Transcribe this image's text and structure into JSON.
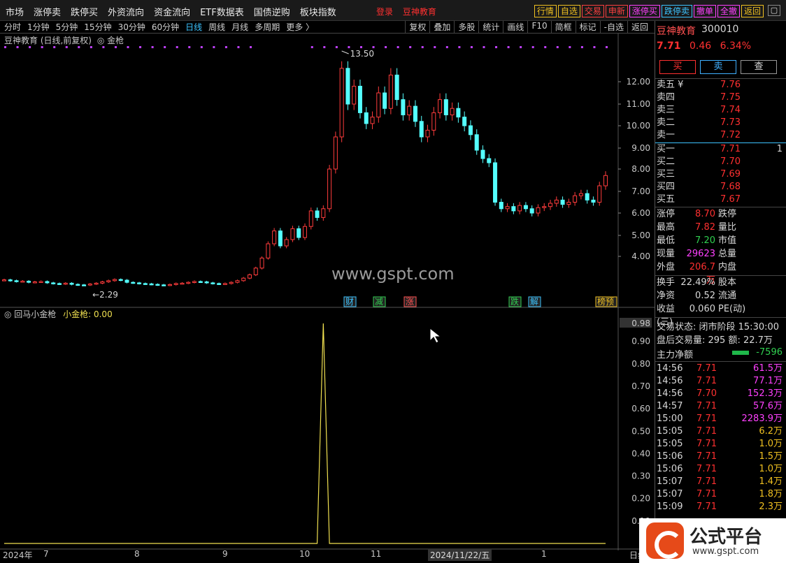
{
  "top_menu": [
    "市场",
    "涨停卖",
    "跌停买",
    "外资流向",
    "资金流向",
    "ETF数据表",
    "国债逆购",
    "板块指数"
  ],
  "brand": {
    "login": "登录",
    "name": "豆神教育"
  },
  "quick_buttons": [
    {
      "label": "行情",
      "color": "#f0c020"
    },
    {
      "label": "自选",
      "color": "#f0c020"
    },
    {
      "label": "交易",
      "color": "#ff4040"
    },
    {
      "label": "申新",
      "color": "#ff4040"
    },
    {
      "label": "涨停买",
      "color": "#ff40ff"
    },
    {
      "label": "跌停卖",
      "color": "#3cc3ff"
    },
    {
      "label": "撤单",
      "color": "#ff40ff"
    },
    {
      "label": "全撤",
      "color": "#ff40ff"
    },
    {
      "label": "返回",
      "color": "#f0c020"
    }
  ],
  "periods": [
    {
      "label": "分时",
      "active": false
    },
    {
      "label": "1分钟",
      "active": false
    },
    {
      "label": "5分钟",
      "active": false
    },
    {
      "label": "15分钟",
      "active": false
    },
    {
      "label": "30分钟",
      "active": false
    },
    {
      "label": "60分钟",
      "active": false
    },
    {
      "label": "日线",
      "active": true
    },
    {
      "label": "周线",
      "active": false
    },
    {
      "label": "月线",
      "active": false
    },
    {
      "label": "多周期",
      "active": false
    },
    {
      "label": "更多 〉",
      "active": false
    }
  ],
  "tools": [
    "复权",
    "叠加",
    "多股",
    "统计",
    "画线",
    "F10",
    "简框",
    "标记",
    "-自选",
    "返回"
  ],
  "main_chart": {
    "title": "豆神教育 (日线,前复权)",
    "indicator": "◎ 金枪",
    "high_label": "13.50",
    "low_label": "2.29",
    "watermark": "www.gspt.com",
    "event_tags": [
      {
        "label": "财",
        "color": "#3cc3ff"
      },
      {
        "label": "减",
        "color": "#30d050"
      },
      {
        "label": "涨",
        "color": "#ff5050"
      },
      {
        "label": "跌",
        "color": "#30d050"
      },
      {
        "label": "解",
        "color": "#3cc3ff"
      },
      {
        "label": "榜预",
        "color": "#f0c020"
      }
    ]
  },
  "sub_chart": {
    "title": "◎ 回马小金枪",
    "value_label": "小金枪: 0.00",
    "max_label": "0.98"
  },
  "dates": {
    "year": "2024年",
    "months": [
      "7",
      "8",
      "9",
      "10",
      "11",
      "1"
    ],
    "cursor_date": "2024/11/22/五",
    "end": "日线"
  },
  "chart_data": [
    {
      "type": "candlestick",
      "title": "豆神教育 (日线,前复权)",
      "y_axis_ticks": [
        "12.00",
        "11.00",
        "10.00",
        "9.00",
        "8.00",
        "7.00",
        "6.00",
        "5.00",
        "4.00"
      ],
      "close_series": [
        2.6,
        2.55,
        2.5,
        2.52,
        2.45,
        2.48,
        2.5,
        2.42,
        2.38,
        2.35,
        2.4,
        2.33,
        2.3,
        2.29,
        2.35,
        2.4,
        2.48,
        2.55,
        2.62,
        2.58,
        2.45,
        2.42,
        2.38,
        2.36,
        2.33,
        2.3,
        2.28,
        2.32,
        2.38,
        2.4,
        2.45,
        2.5,
        2.48,
        2.42,
        2.38,
        2.35,
        2.38,
        2.45,
        2.55,
        2.7,
        2.9,
        3.3,
        3.9,
        4.6,
        5.2,
        4.5,
        4.8,
        5.3,
        4.9,
        5.4,
        6.1,
        5.8,
        6.2,
        8.0,
        9.5,
        12.6,
        11.0,
        11.8,
        10.6,
        10.1,
        10.4,
        11.5,
        10.8,
        12.3,
        11.2,
        10.5,
        10.9,
        10.2,
        9.5,
        9.8,
        10.6,
        11.2,
        10.5,
        10.8,
        10.4,
        10.0,
        9.6,
        8.9,
        8.5,
        8.3,
        6.5,
        6.2,
        6.3,
        6.1,
        6.35,
        6.2,
        6.0,
        6.25,
        6.3,
        6.45,
        6.6,
        6.4,
        6.5,
        6.8,
        6.9,
        6.6,
        6.5,
        7.25,
        7.71
      ],
      "high_marker": "13.50",
      "low_marker": "2.29"
    },
    {
      "type": "line",
      "title": "回马小金枪",
      "series_name": "小金枪",
      "y_axis_ticks": [
        "0.98",
        "0.90",
        "0.80",
        "0.70",
        "0.60",
        "0.50",
        "0.40",
        "0.30",
        "0.20",
        "0.10"
      ],
      "spike_index": 52,
      "spike_value": 0.98,
      "last_value": 0.0
    }
  ],
  "right_panel": {
    "name": "豆神教育",
    "code": "300010",
    "price": "7.71",
    "change": "0.46",
    "change_pct": "6.34%",
    "buttons": {
      "buy": "买",
      "sell": "卖",
      "query": "查"
    },
    "asks": [
      {
        "label": "卖五 ¥",
        "price": "7.76"
      },
      {
        "label": "卖四",
        "price": "7.75"
      },
      {
        "label": "卖三",
        "price": "7.74"
      },
      {
        "label": "卖二",
        "price": "7.73"
      },
      {
        "label": "卖一",
        "price": "7.72"
      }
    ],
    "bids": [
      {
        "label": "买一",
        "price": "7.71",
        "vol": "1"
      },
      {
        "label": "买二",
        "price": "7.70",
        "vol": ""
      },
      {
        "label": "买三",
        "price": "7.69",
        "vol": ""
      },
      {
        "label": "买四",
        "price": "7.68",
        "vol": ""
      },
      {
        "label": "买五",
        "price": "7.67",
        "vol": ""
      }
    ],
    "stats": [
      {
        "k": "涨停",
        "v": "8.70",
        "color": "#ff3030",
        "k2": "跌停"
      },
      {
        "k": "最高",
        "v": "7.82",
        "color": "#ff3030",
        "k2": "量比"
      },
      {
        "k": "最低",
        "v": "7.20",
        "color": "#30d050",
        "k2": "市值"
      },
      {
        "k": "现量",
        "v": "29623",
        "color": "#ff40ff",
        "k2": "总量"
      },
      {
        "k": "外盘",
        "v": "206.7万",
        "color": "#ff3030",
        "k2": "内盘"
      }
    ],
    "stats2": [
      {
        "k": "换手",
        "v": "22.49%",
        "color": "#d8d8d8",
        "k2": "股本"
      },
      {
        "k": "净资",
        "v": "0.52",
        "color": "#d8d8d8",
        "k2": "流通"
      },
      {
        "k": "收益(三)",
        "v": "0.060",
        "color": "#d8d8d8",
        "k2": "PE(动)"
      }
    ],
    "trade_status": "交易状态: 闭市阶段 15:30:00",
    "after_hours": "盘后交易量: 295  额: 22.7万",
    "main_flow_label": "主力净额",
    "main_flow_value": "-7596",
    "ticks": [
      {
        "t": "14:56",
        "p": "7.71",
        "v": "61.5万",
        "c": "#ff40ff"
      },
      {
        "t": "14:56",
        "p": "7.71",
        "v": "77.1万",
        "c": "#ff40ff"
      },
      {
        "t": "14:56",
        "p": "7.70",
        "v": "152.3万",
        "c": "#ff40ff"
      },
      {
        "t": "14:57",
        "p": "7.71",
        "v": "57.6万",
        "c": "#ff40ff"
      },
      {
        "t": "15:00",
        "p": "7.71",
        "v": "2283.9万",
        "c": "#ff40ff"
      },
      {
        "t": "15:05",
        "p": "7.71",
        "v": "6.2万",
        "c": "#f0c020"
      },
      {
        "t": "15:05",
        "p": "7.71",
        "v": "1.0万",
        "c": "#f0c020"
      },
      {
        "t": "15:06",
        "p": "7.71",
        "v": "1.5万",
        "c": "#f0c020"
      },
      {
        "t": "15:06",
        "p": "7.71",
        "v": "1.0万",
        "c": "#f0c020"
      },
      {
        "t": "15:07",
        "p": "7.71",
        "v": "1.4万",
        "c": "#f0c020"
      },
      {
        "t": "15:07",
        "p": "7.71",
        "v": "1.8万",
        "c": "#f0c020"
      },
      {
        "t": "15:09",
        "p": "7.71",
        "v": "2.3万",
        "c": "#f0c020"
      }
    ]
  },
  "logo": {
    "title": "公式平台",
    "url": "www.gspt.com"
  }
}
